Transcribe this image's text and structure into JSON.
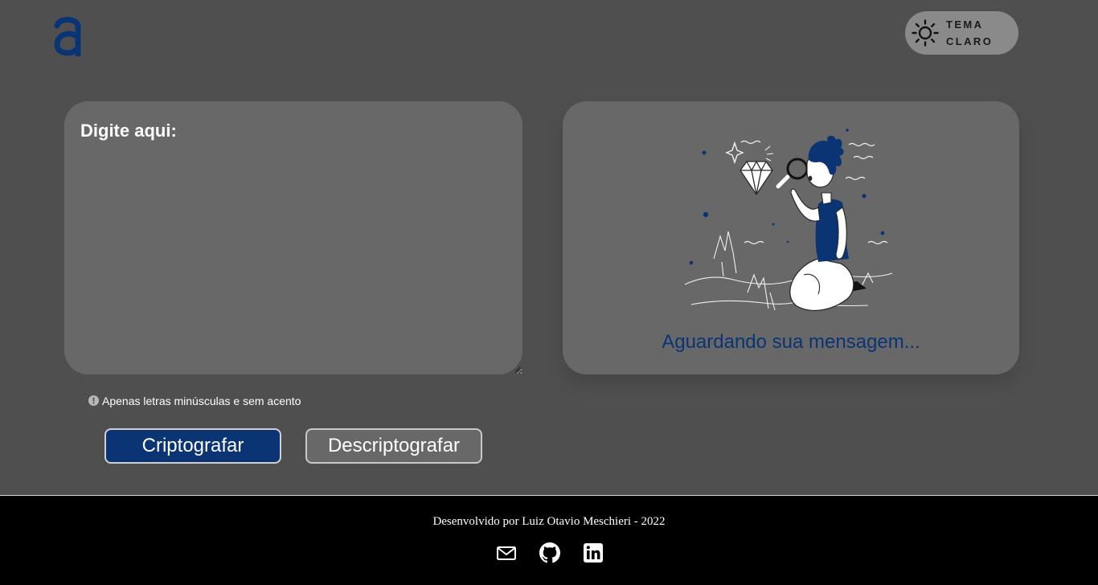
{
  "header": {
    "logo_icon": "alura-logo-icon",
    "theme_toggle": {
      "icon": "sun-icon",
      "label_line1": "TEMA",
      "label_line2": "CLARO"
    }
  },
  "input": {
    "placeholder": "Digite aqui:",
    "value": ""
  },
  "output": {
    "illustration": "person-with-magnifying-glass-illustration",
    "waiting_text": "Aguardando sua mensagem..."
  },
  "hint": {
    "icon": "info-icon",
    "text": "Apenas letras minúsculas e sem acento"
  },
  "buttons": {
    "encrypt_label": "Criptografar",
    "decrypt_label": "Descriptografar"
  },
  "footer": {
    "credits": "Desenvolvido por Luiz Otavio Meschieri - 2022",
    "social_icons": [
      "email-icon",
      "github-icon",
      "linkedin-icon"
    ]
  },
  "colors": {
    "background": "#4f4f4f",
    "card": "#686868",
    "accent": "#0a3473",
    "footer": "#000000",
    "toggle": "#8a8a8a"
  }
}
